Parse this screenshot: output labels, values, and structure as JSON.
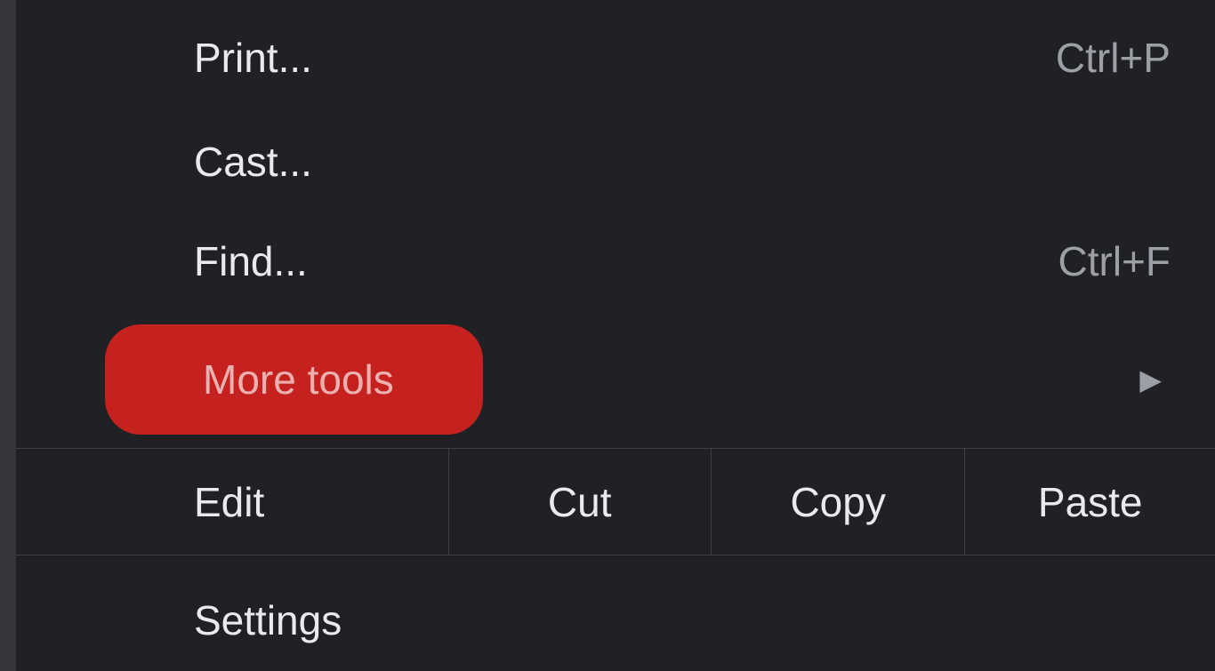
{
  "menu": {
    "print": {
      "label": "Print...",
      "shortcut": "Ctrl+P"
    },
    "cast": {
      "label": "Cast..."
    },
    "find": {
      "label": "Find...",
      "shortcut": "Ctrl+F"
    },
    "moreTools": {
      "label": "More tools"
    },
    "edit": {
      "label": "Edit",
      "cut": "Cut",
      "copy": "Copy",
      "paste": "Paste"
    },
    "settings": {
      "label": "Settings"
    }
  }
}
